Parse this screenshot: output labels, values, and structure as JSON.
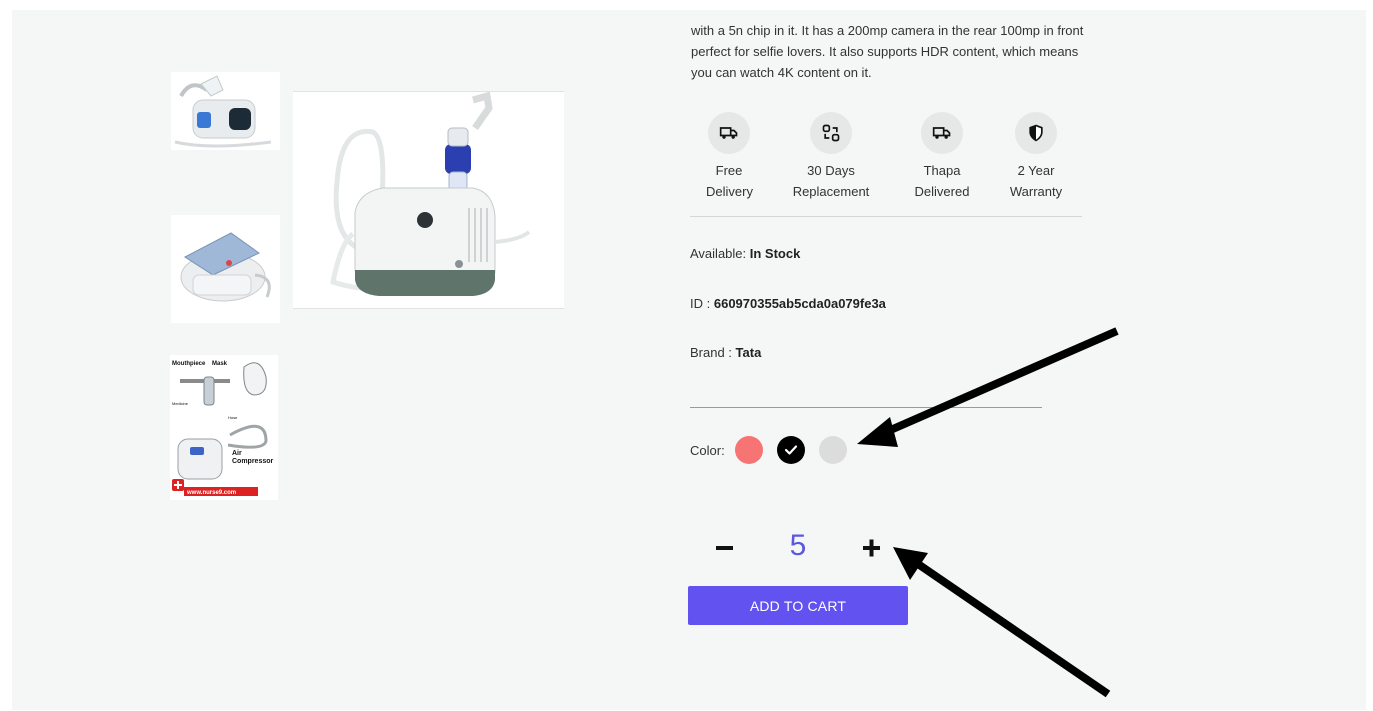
{
  "product": {
    "description": "with a 5n chip in it. It has a 200mp camera in the rear 100mp in front perfect for selfie lovers. It also supports HDR content, which means you can watch 4K content on it.",
    "thumbnail_overlay_text": "Air Compressor",
    "thumbnail_watermark": "www.nurse9.com"
  },
  "features": [
    {
      "label": "Free\nDelivery",
      "icon": "truck-icon"
    },
    {
      "label": "30 Days\nReplacement",
      "icon": "exchange-icon"
    },
    {
      "label": "Thapa\nDelivered",
      "icon": "truck-icon"
    },
    {
      "label": "2 Year\nWarranty",
      "icon": "shield-icon"
    }
  ],
  "info": {
    "available_label": "Available:",
    "available_value": "In Stock",
    "id_label": "ID :",
    "id_value": "660970355ab5cda0a079fe3a",
    "brand_label": "Brand :",
    "brand_value": "Tata"
  },
  "colors": {
    "label": "Color:",
    "options": [
      "#f77474",
      "#000000",
      "#dcdcdc"
    ],
    "selected_index": 1
  },
  "quantity": {
    "minus": "−",
    "value": "5",
    "plus": "+"
  },
  "cart": {
    "button_label": "ADD TO CART"
  },
  "theme": {
    "accent": "#6253f1",
    "quantity_color": "#5a58e0"
  }
}
